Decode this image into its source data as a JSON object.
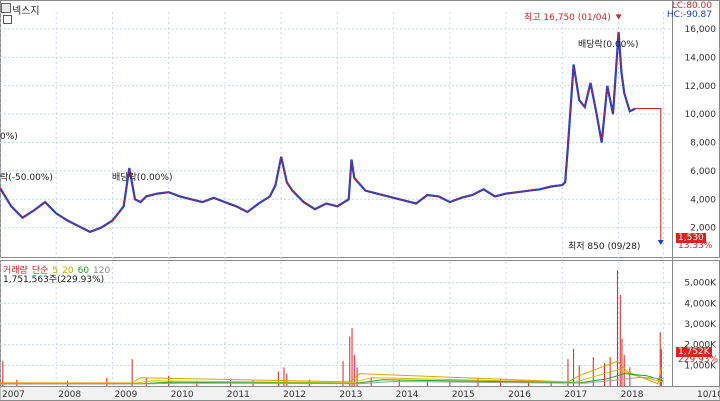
{
  "header": {
    "stock_name": "넥스지",
    "lc_label": "LC:80.00",
    "hc_label": "HC:-90.87"
  },
  "annotations": {
    "high": "최고 16,750 (01/04)",
    "low": "최저 850 (09/28)",
    "div1": "배당락(0.00%)",
    "div2": "배당락(0.00%)",
    "div3": "락(-50.00%)",
    "left_pct": "0%)"
  },
  "badges": {
    "price_current": "1,530",
    "price_pct": "13.33%",
    "vol_current": "1,752K",
    "vol_pct": "229.93%"
  },
  "volume_legend": {
    "name": "거래량",
    "ma_label": "단순",
    "ma5": "5",
    "ma20": "20",
    "ma60": "60",
    "ma120": "120",
    "value": "1,751,563주(229.93%)"
  },
  "colors": {
    "up": "#e02020",
    "down": "#1a3fd0",
    "ma5": "#e0a000",
    "ma20": "#d0c000",
    "ma60": "#20a020",
    "ma120": "#a0a0a0",
    "grid": "#c8d4e8"
  },
  "chart_data": {
    "type": "line",
    "price": {
      "y_ticks": [
        "2,000",
        "4,000",
        "6,000",
        "8,000",
        "10,000",
        "12,000",
        "14,000",
        "16,000"
      ],
      "y_tick_values": [
        2000,
        4000,
        6000,
        8000,
        10000,
        12000,
        14000,
        16000
      ],
      "ylim": [
        0,
        17200
      ],
      "series": [
        {
          "x": [
            2007.0,
            2007.2,
            2007.4,
            2007.6,
            2007.8,
            2008.0,
            2008.2,
            2008.4,
            2008.6,
            2008.8,
            2009.0,
            2009.2,
            2009.3,
            2009.4,
            2009.5,
            2009.6,
            2009.8,
            2010.0,
            2010.2,
            2010.4,
            2010.6,
            2010.8,
            2011.0,
            2011.2,
            2011.4,
            2011.6,
            2011.8,
            2011.9,
            2012.0,
            2012.1,
            2012.2,
            2012.4,
            2012.6,
            2012.8,
            2013.0,
            2013.2,
            2013.25,
            2013.3,
            2013.5,
            2013.7,
            2014.0,
            2014.2,
            2014.4,
            2014.6,
            2014.8,
            2015.0,
            2015.2,
            2015.4,
            2015.6,
            2015.8,
            2016.0,
            2016.2,
            2016.4,
            2016.6,
            2016.8,
            2017.0,
            2017.05,
            2017.1,
            2017.2,
            2017.3,
            2017.4,
            2017.5,
            2017.6,
            2017.7,
            2017.8,
            2017.9,
            2018.0,
            2018.05,
            2018.1,
            2018.2,
            2018.3
          ],
          "y": [
            4800,
            3500,
            2700,
            3200,
            3800,
            3000,
            2500,
            2100,
            1700,
            2000,
            2500,
            3500,
            6200,
            4000,
            3800,
            4200,
            4400,
            4500,
            4200,
            4000,
            3800,
            4100,
            3800,
            3500,
            3100,
            3700,
            4200,
            5000,
            7000,
            5200,
            4600,
            3800,
            3300,
            3700,
            3500,
            4000,
            6800,
            5500,
            4600,
            4400,
            4100,
            3900,
            3700,
            4300,
            4200,
            3800,
            4100,
            4300,
            4700,
            4200,
            4400,
            4500,
            4600,
            4700,
            4900,
            5000,
            5200,
            7800,
            13500,
            11000,
            10500,
            12200,
            10200,
            8000,
            12000,
            10000,
            15800,
            13000,
            11500,
            10200,
            10400
          ]
        }
      ],
      "markers": [
        {
          "x": 2018.0,
          "y": 16750,
          "label": "최고 16,750 (01/04)"
        },
        {
          "x": 2018.75,
          "y": 850,
          "label": "최저 850 (09/28)"
        }
      ]
    },
    "volume": {
      "y_ticks": [
        "1,000K",
        "2,000K",
        "3,000K",
        "4,000K",
        "5,000K"
      ],
      "y_tick_values": [
        1000,
        2000,
        3000,
        4000,
        5000
      ],
      "ylim": [
        0,
        5900
      ],
      "spikes": [
        {
          "x": 2007.05,
          "v": 1200
        },
        {
          "x": 2007.3,
          "v": 300
        },
        {
          "x": 2008.2,
          "v": 250
        },
        {
          "x": 2008.9,
          "v": 400
        },
        {
          "x": 2009.35,
          "v": 1300
        },
        {
          "x": 2009.6,
          "v": 400
        },
        {
          "x": 2010.0,
          "v": 500
        },
        {
          "x": 2010.5,
          "v": 250
        },
        {
          "x": 2011.1,
          "v": 350
        },
        {
          "x": 2011.5,
          "v": 300
        },
        {
          "x": 2011.95,
          "v": 700
        },
        {
          "x": 2012.05,
          "v": 900
        },
        {
          "x": 2012.1,
          "v": 600
        },
        {
          "x": 2012.5,
          "v": 300
        },
        {
          "x": 2013.1,
          "v": 1200
        },
        {
          "x": 2013.22,
          "v": 2400
        },
        {
          "x": 2013.26,
          "v": 2800
        },
        {
          "x": 2013.3,
          "v": 1500
        },
        {
          "x": 2013.35,
          "v": 900
        },
        {
          "x": 2013.6,
          "v": 400
        },
        {
          "x": 2014.1,
          "v": 300
        },
        {
          "x": 2014.6,
          "v": 250
        },
        {
          "x": 2015.0,
          "v": 200
        },
        {
          "x": 2015.5,
          "v": 400
        },
        {
          "x": 2015.9,
          "v": 350
        },
        {
          "x": 2016.4,
          "v": 300
        },
        {
          "x": 2016.8,
          "v": 200
        },
        {
          "x": 2017.1,
          "v": 1300
        },
        {
          "x": 2017.2,
          "v": 1800
        },
        {
          "x": 2017.3,
          "v": 1000
        },
        {
          "x": 2017.55,
          "v": 1400
        },
        {
          "x": 2017.75,
          "v": 1100
        },
        {
          "x": 2017.85,
          "v": 1400
        },
        {
          "x": 2017.98,
          "v": 5600
        },
        {
          "x": 2018.03,
          "v": 4400
        },
        {
          "x": 2018.06,
          "v": 2300
        },
        {
          "x": 2018.1,
          "v": 1500
        },
        {
          "x": 2018.2,
          "v": 900
        },
        {
          "x": 2018.74,
          "v": 2600
        },
        {
          "x": 2018.76,
          "v": 1800
        }
      ],
      "ma": [
        {
          "name": "5",
          "x": [
            2007.0,
            2009.35,
            2009.5,
            2013.22,
            2013.4,
            2017.1,
            2017.3,
            2017.98,
            2018.15,
            2018.7,
            2018.76
          ],
          "y": [
            150,
            150,
            400,
            200,
            600,
            200,
            500,
            1200,
            700,
            100,
            900
          ]
        },
        {
          "name": "20",
          "x": [
            2007.0,
            2009.4,
            2009.7,
            2013.26,
            2013.6,
            2017.2,
            2017.5,
            2018.0,
            2018.3,
            2018.8
          ],
          "y": [
            120,
            130,
            250,
            150,
            400,
            180,
            400,
            800,
            500,
            200
          ]
        },
        {
          "name": "60",
          "x": [
            2007.0,
            2009.5,
            2010.0,
            2013.3,
            2013.8,
            2017.3,
            2017.8,
            2018.1,
            2018.5,
            2018.8
          ],
          "y": [
            100,
            110,
            180,
            120,
            300,
            150,
            350,
            600,
            500,
            250
          ]
        },
        {
          "name": "120",
          "x": [
            2007.0,
            2009.6,
            2010.3,
            2013.4,
            2014.0,
            2017.4,
            2018.0,
            2018.4,
            2018.8
          ],
          "y": [
            90,
            100,
            140,
            110,
            220,
            130,
            300,
            420,
            350
          ]
        }
      ]
    },
    "x_ticks": [
      "2007",
      "2008",
      "2009",
      "2010",
      "2011",
      "2012",
      "2013",
      "2014",
      "2015",
      "2016",
      "2017",
      "2018",
      "10/10"
    ],
    "x_tick_values": [
      2007.0,
      2008.0,
      2009.0,
      2010.0,
      2011.0,
      2012.0,
      2013.0,
      2014.0,
      2015.0,
      2016.0,
      2017.0,
      2018.0,
      2018.8
    ],
    "xlim": [
      2007.0,
      2018.95
    ],
    "grid": true
  }
}
